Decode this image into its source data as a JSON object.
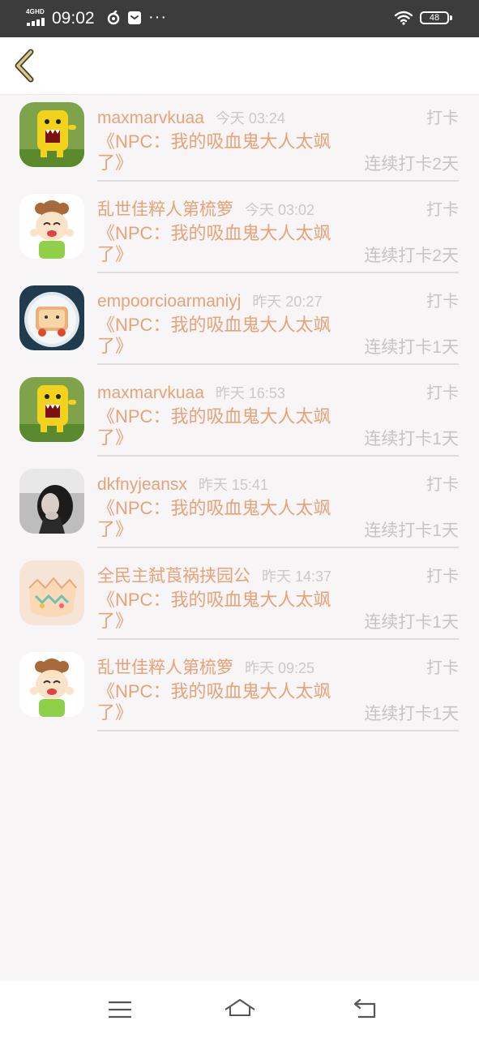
{
  "status_bar": {
    "network": "4GHD",
    "time": "09:02",
    "more": "···",
    "battery": "48",
    "battery_level": 0.48,
    "icons": [
      "signal-icon",
      "netease-icon",
      "message-icon",
      "wifi-icon",
      "battery-icon"
    ]
  },
  "header": {
    "back_icon": "chevron-left-icon",
    "accent_color": "#e0c57a"
  },
  "colors": {
    "username": "#e7a27a",
    "muted": "#c4c4c4",
    "background": "#f7f5f5"
  },
  "feed": [
    {
      "username": "maxmarvkuaa",
      "time": "今天 03:24",
      "action": "打卡",
      "book": "《NPC：我的吸血鬼大人太飒了》",
      "streak": "连续打卡2天",
      "avatar": "yellow-monster-avatar"
    },
    {
      "username": "乱世佳粹人第梳箩",
      "time": "今天 03:02",
      "action": "打卡",
      "book": "《NPC：我的吸血鬼大人太飒了》",
      "streak": "连续打卡2天",
      "avatar": "cartoon-girl-avatar"
    },
    {
      "username": "empoorcioarmaniyj",
      "time": "昨天 20:27",
      "action": "打卡",
      "book": "《NPC：我的吸血鬼大人太飒了》",
      "streak": "连续打卡1天",
      "avatar": "toast-avatar"
    },
    {
      "username": "maxmarvkuaa",
      "time": "昨天 16:53",
      "action": "打卡",
      "book": "《NPC：我的吸血鬼大人太飒了》",
      "streak": "连续打卡1天",
      "avatar": "yellow-monster-avatar"
    },
    {
      "username": "dkfnyjeansx",
      "time": "昨天 15:41",
      "action": "打卡",
      "book": "《NPC：我的吸血鬼大人太飒了》",
      "streak": "连续打卡1天",
      "avatar": "woman-photo-avatar"
    },
    {
      "username": "全民主弑莨祸挟园公",
      "time": "昨天 14:37",
      "action": "打卡",
      "book": "《NPC：我的吸血鬼大人太飒了》",
      "streak": "连续打卡1天",
      "avatar": "eggshell-avatar"
    },
    {
      "username": "乱世佳粹人第梳箩",
      "time": "昨天 09:25",
      "action": "打卡",
      "book": "《NPC：我的吸血鬼大人太飒了》",
      "streak": "连续打卡1天",
      "avatar": "cartoon-girl-avatar"
    }
  ],
  "nav_bar": {
    "icons": [
      "menu-icon",
      "home-icon",
      "back-nav-icon"
    ]
  }
}
